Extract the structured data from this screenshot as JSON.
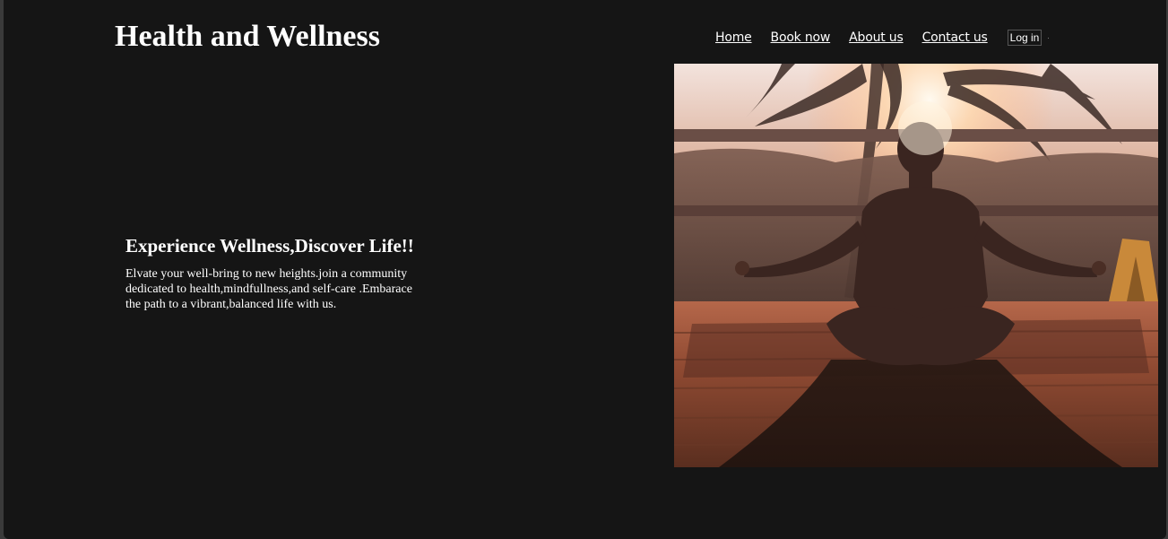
{
  "header": {
    "title": "Health and Wellness"
  },
  "nav": {
    "items": [
      {
        "label": "Home"
      },
      {
        "label": "Book now"
      },
      {
        "label": "About us"
      },
      {
        "label": "Contact us"
      }
    ],
    "login_label": "Log in"
  },
  "hero": {
    "heading": "Experience Wellness,Discover Life!!",
    "body": "Elvate your well-bring to new heights.join a community dedicated to health,mindfullness,and self-care .Embarace the path to a vibrant,balanced life with us.",
    "image_subject": "person-meditating-at-sunset"
  },
  "colors": {
    "background": "#151515",
    "text": "#ffffff",
    "sunset_warm": "#c46a3c"
  }
}
